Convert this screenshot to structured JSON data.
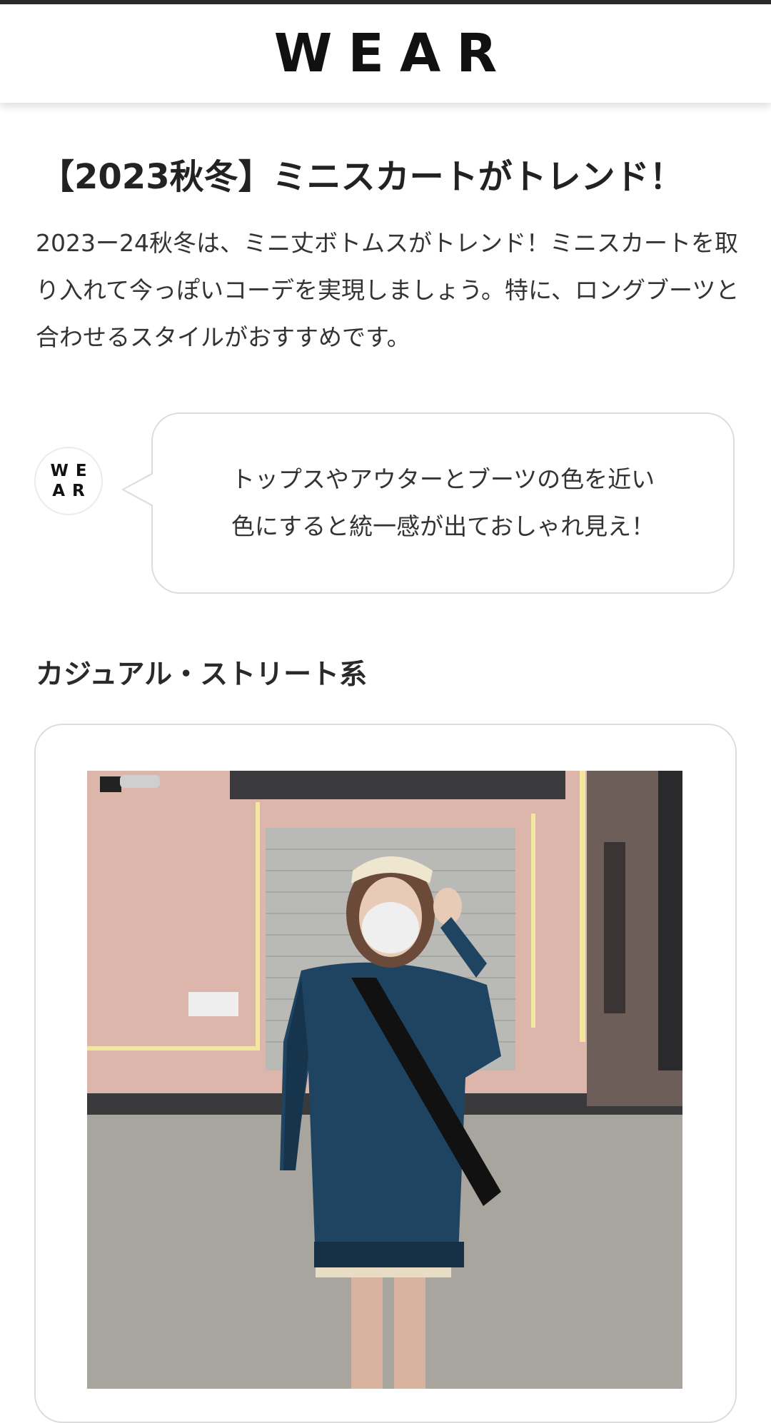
{
  "header": {
    "logo": "WEAR"
  },
  "article": {
    "title": "【2023秋冬】ミニスカートがトレンド！",
    "intro": "2023ー24秋冬は、ミニ丈ボトムスがトレンド！ミニスカートを取り入れて今っぽいコーデを実現しましょう。特に、ロングブーツと合わせるスタイルがおすすめです。"
  },
  "tip": {
    "avatar_line1": "WE",
    "avatar_line2": "AR",
    "line1": "トップスやアウターとブーツの色を近い",
    "line2": "色にすると統一感が出ておしゃれ見え！"
  },
  "section": {
    "heading": "カジュアル・ストリート系"
  },
  "colors": {
    "accent": "#111111",
    "border": "#dcdcdc",
    "text": "#222222"
  }
}
